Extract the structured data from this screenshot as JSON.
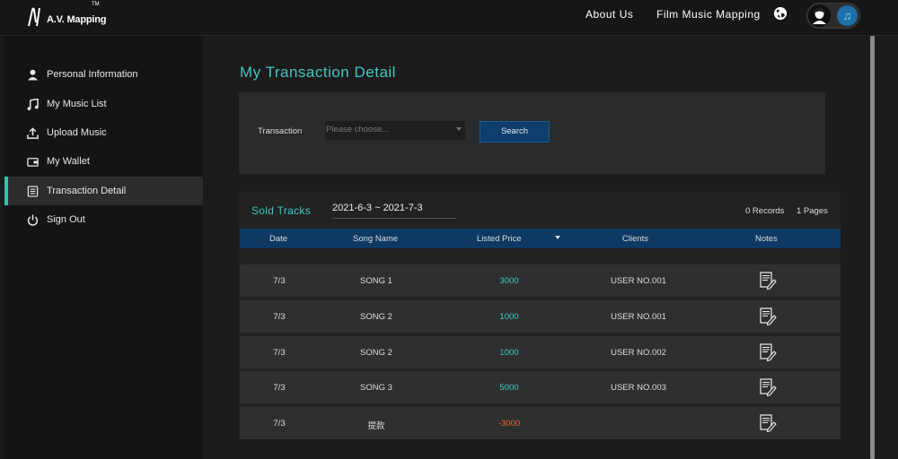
{
  "header": {
    "logo_text": "A.V. Mapping",
    "logo_tm": "TM",
    "nav": [
      {
        "label": "About Us"
      },
      {
        "label": "Film Music Mapping"
      }
    ],
    "language_icon": "globe-icon",
    "toggle_icon": "music-note-icon"
  },
  "sidebar": {
    "items": [
      {
        "label": "Personal Information",
        "icon": "person-icon"
      },
      {
        "label": "My Music List",
        "icon": "music-note-icon"
      },
      {
        "label": "Upload Music",
        "icon": "upload-icon"
      },
      {
        "label": "My Wallet",
        "icon": "wallet-icon"
      },
      {
        "label": "Transaction Detail",
        "icon": "document-list-icon",
        "active": true
      },
      {
        "label": "Sign Out",
        "icon": "power-icon"
      }
    ]
  },
  "page": {
    "title": "My Transaction Detail"
  },
  "filter": {
    "label": "Transaction",
    "placeholder": "Please choose...",
    "search_label": "Search"
  },
  "table_section": {
    "title": "Sold Tracks",
    "date_range": "2021-6-3 ~ 2021-7-3",
    "records": "0 Records",
    "pages": "1 Pages",
    "columns": [
      "Date",
      "Song Name",
      "Listed Price",
      "Clients",
      "Notes"
    ],
    "rows": [
      {
        "date": "7/3",
        "song": "SONG 1",
        "price": "3000",
        "client": "USER NO.001"
      },
      {
        "date": "7/3",
        "song": "SONG 2",
        "price": "1000",
        "client": "USER NO.001"
      },
      {
        "date": "7/3",
        "song": "SONG 2",
        "price": "1000",
        "client": "USER NO.002"
      },
      {
        "date": "7/3",
        "song": "SONG 3",
        "price": "5000",
        "client": "USER NO.003"
      },
      {
        "date": "7/3",
        "song": "提款",
        "price": "-3000",
        "client": ""
      }
    ]
  },
  "colors": {
    "accent": "#3ec9c1",
    "header_row": "#0d3962",
    "negative": "#e2683c"
  }
}
